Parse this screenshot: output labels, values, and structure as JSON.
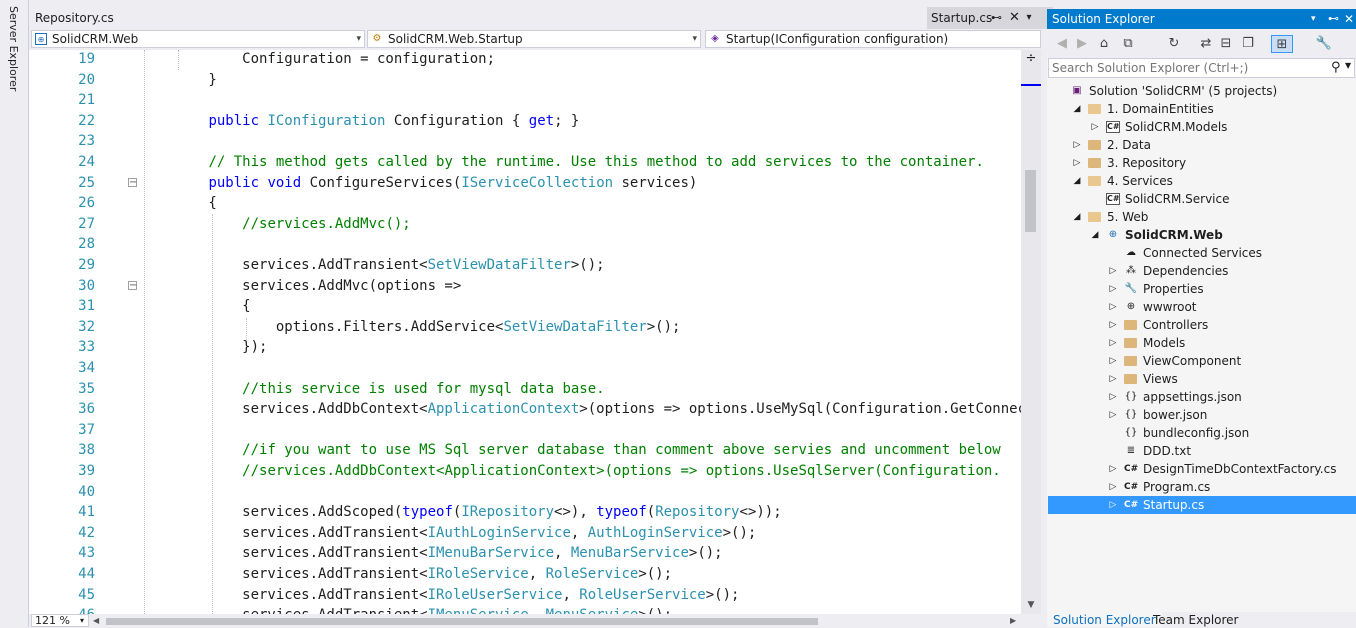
{
  "server_explorer": {
    "label": "Server Explorer"
  },
  "tabs": {
    "repository": "Repository.cs",
    "startup": "Startup.cs",
    "pin_glyph": "⊷",
    "close_glyph": "✕",
    "dropdown_glyph": "▾"
  },
  "navbar": {
    "project": "SolidCRM.Web",
    "type": "SolidCRM.Web.Startup",
    "member": "Startup(IConfiguration configuration)",
    "caret": "▾"
  },
  "editor": {
    "lines": [
      {
        "num": "19",
        "segs": [
          [
            "p",
            "            Configuration = configuration;"
          ]
        ]
      },
      {
        "num": "20",
        "segs": [
          [
            "p",
            "        }"
          ]
        ]
      },
      {
        "num": "21",
        "segs": []
      },
      {
        "num": "22",
        "segs": [
          [
            "p",
            "        "
          ],
          [
            "k",
            "public"
          ],
          [
            "p",
            " "
          ],
          [
            "t",
            "IConfiguration"
          ],
          [
            "p",
            " Configuration { "
          ],
          [
            "k",
            "get"
          ],
          [
            "p",
            "; }"
          ]
        ]
      },
      {
        "num": "23",
        "segs": []
      },
      {
        "num": "24",
        "segs": [
          [
            "p",
            "        "
          ],
          [
            "c",
            "// This method gets called by the runtime. Use this method to add services to the container."
          ]
        ]
      },
      {
        "num": "25",
        "segs": [
          [
            "p",
            "        "
          ],
          [
            "k",
            "public"
          ],
          [
            "p",
            " "
          ],
          [
            "k",
            "void"
          ],
          [
            "p",
            " ConfigureServices("
          ],
          [
            "t",
            "IServiceCollection"
          ],
          [
            "p",
            " services)"
          ]
        ],
        "fold": "−"
      },
      {
        "num": "26",
        "segs": [
          [
            "p",
            "        {"
          ]
        ]
      },
      {
        "num": "27",
        "segs": [
          [
            "p",
            "            "
          ],
          [
            "c",
            "//services.AddMvc();"
          ]
        ]
      },
      {
        "num": "28",
        "segs": []
      },
      {
        "num": "29",
        "segs": [
          [
            "p",
            "            services.AddTransient<"
          ],
          [
            "t",
            "SetViewDataFilter"
          ],
          [
            "p",
            ">();"
          ]
        ]
      },
      {
        "num": "30",
        "segs": [
          [
            "p",
            "            services.AddMvc(options =>"
          ]
        ],
        "fold": "−"
      },
      {
        "num": "31",
        "segs": [
          [
            "p",
            "            {"
          ]
        ]
      },
      {
        "num": "32",
        "segs": [
          [
            "p",
            "                options.Filters.AddService<"
          ],
          [
            "t",
            "SetViewDataFilter"
          ],
          [
            "p",
            ">();"
          ]
        ]
      },
      {
        "num": "33",
        "segs": [
          [
            "p",
            "            });"
          ]
        ]
      },
      {
        "num": "34",
        "segs": []
      },
      {
        "num": "35",
        "segs": [
          [
            "p",
            "            "
          ],
          [
            "c",
            "//this service is used for mysql data base."
          ]
        ]
      },
      {
        "num": "36",
        "segs": [
          [
            "p",
            "            services.AddDbContext<"
          ],
          [
            "t",
            "ApplicationContext"
          ],
          [
            "p",
            ">(options => options.UseMySql(Configuration.GetConnectionString("
          ]
        ]
      },
      {
        "num": "37",
        "segs": []
      },
      {
        "num": "38",
        "segs": [
          [
            "p",
            "            "
          ],
          [
            "c",
            "//if you want to use MS Sql server database than comment above servies and uncomment below"
          ]
        ]
      },
      {
        "num": "39",
        "segs": [
          [
            "p",
            "            "
          ],
          [
            "c",
            "//services.AddDbContext<ApplicationContext>(options => options.UseSqlServer(Configuration."
          ]
        ]
      },
      {
        "num": "40",
        "segs": []
      },
      {
        "num": "41",
        "segs": [
          [
            "p",
            "            services.AddScoped("
          ],
          [
            "k",
            "typeof"
          ],
          [
            "p",
            "("
          ],
          [
            "t",
            "IRepository"
          ],
          [
            "p",
            "<>), "
          ],
          [
            "k",
            "typeof"
          ],
          [
            "p",
            "("
          ],
          [
            "t",
            "Repository"
          ],
          [
            "p",
            "<>));"
          ]
        ]
      },
      {
        "num": "42",
        "segs": [
          [
            "p",
            "            services.AddTransient<"
          ],
          [
            "t",
            "IAuthLoginService"
          ],
          [
            "p",
            ", "
          ],
          [
            "t",
            "AuthLoginService"
          ],
          [
            "p",
            ">();"
          ]
        ]
      },
      {
        "num": "43",
        "segs": [
          [
            "p",
            "            services.AddTransient<"
          ],
          [
            "t",
            "IMenuBarService"
          ],
          [
            "p",
            ", "
          ],
          [
            "t",
            "MenuBarService"
          ],
          [
            "p",
            ">();"
          ]
        ]
      },
      {
        "num": "44",
        "segs": [
          [
            "p",
            "            services.AddTransient<"
          ],
          [
            "t",
            "IRoleService"
          ],
          [
            "p",
            ", "
          ],
          [
            "t",
            "RoleService"
          ],
          [
            "p",
            ">();"
          ]
        ]
      },
      {
        "num": "45",
        "segs": [
          [
            "p",
            "            services.AddTransient<"
          ],
          [
            "t",
            "IRoleUserService"
          ],
          [
            "p",
            ", "
          ],
          [
            "t",
            "RoleUserService"
          ],
          [
            "p",
            ">();"
          ]
        ]
      },
      {
        "num": "46",
        "segs": [
          [
            "p",
            "            services.AddTransient<"
          ],
          [
            "t",
            "IMenuService"
          ],
          [
            "p",
            ", "
          ],
          [
            "t",
            "MenuService"
          ],
          [
            "p",
            ">();"
          ]
        ]
      }
    ],
    "colors": {
      "keyword": "#0000ff",
      "type": "#2b91af",
      "comment": "#008000",
      "plain": "#1e1e1e",
      "line_number": "#2b91af"
    }
  },
  "zoom": {
    "value": "121 %",
    "caret": "▾"
  },
  "solution_explorer": {
    "title": "Solution Explorer",
    "title_buttons": [
      "▾",
      "⊷",
      "✕"
    ],
    "toolbar_icons": [
      {
        "name": "back-icon",
        "glyph": "◀"
      },
      {
        "name": "forward-icon",
        "glyph": "▶"
      },
      {
        "name": "home-icon",
        "glyph": "⌂"
      },
      {
        "name": "switch-views-icon",
        "glyph": "⧉"
      },
      {
        "name": "pending-changes-icon",
        "glyph": "↻"
      },
      {
        "name": "sync-icon",
        "glyph": "⇄"
      },
      {
        "name": "collapse-all-icon",
        "glyph": "⊟"
      },
      {
        "name": "show-all-files-icon",
        "glyph": "❐"
      },
      {
        "name": "preview-selected-icon",
        "glyph": "⊞"
      },
      {
        "name": "properties-icon",
        "glyph": "🔧"
      }
    ],
    "search_placeholder": "Search Solution Explorer (Ctrl+;)",
    "search_glyph": "⚲",
    "tree": [
      {
        "label": "Solution 'SolidCRM' (5 projects)",
        "depth": 0,
        "arrow": "",
        "icon": "solution"
      },
      {
        "label": "1. DomainEntities",
        "depth": 1,
        "arrow": "◢",
        "icon": "folder-open"
      },
      {
        "label": "SolidCRM.Models",
        "depth": 2,
        "arrow": "▷",
        "icon": "csproj"
      },
      {
        "label": "2. Data",
        "depth": 1,
        "arrow": "▷",
        "icon": "folder"
      },
      {
        "label": "3. Repository",
        "depth": 1,
        "arrow": "▷",
        "icon": "folder"
      },
      {
        "label": "4. Services",
        "depth": 1,
        "arrow": "◢",
        "icon": "folder-open"
      },
      {
        "label": "SolidCRM.Service",
        "depth": 2,
        "arrow": "",
        "icon": "csproj"
      },
      {
        "label": "5. Web",
        "depth": 1,
        "arrow": "◢",
        "icon": "folder-open"
      },
      {
        "label": "SolidCRM.Web",
        "depth": 2,
        "arrow": "◢",
        "icon": "webproj",
        "bold": true
      },
      {
        "label": "Connected Services",
        "depth": 3,
        "arrow": "",
        "icon": "connected"
      },
      {
        "label": "Dependencies",
        "depth": 3,
        "arrow": "▷",
        "icon": "deps"
      },
      {
        "label": "Properties",
        "depth": 3,
        "arrow": "▷",
        "icon": "wrench"
      },
      {
        "label": "wwwroot",
        "depth": 3,
        "arrow": "▷",
        "icon": "globe"
      },
      {
        "label": "Controllers",
        "depth": 3,
        "arrow": "▷",
        "icon": "folder"
      },
      {
        "label": "Models",
        "depth": 3,
        "arrow": "▷",
        "icon": "folder"
      },
      {
        "label": "ViewComponent",
        "depth": 3,
        "arrow": "▷",
        "icon": "folder"
      },
      {
        "label": "Views",
        "depth": 3,
        "arrow": "▷",
        "icon": "folder"
      },
      {
        "label": "appsettings.json",
        "depth": 3,
        "arrow": "▷",
        "icon": "json"
      },
      {
        "label": "bower.json",
        "depth": 3,
        "arrow": "▷",
        "icon": "json"
      },
      {
        "label": "bundleconfig.json",
        "depth": 3,
        "arrow": "",
        "icon": "json"
      },
      {
        "label": "DDD.txt",
        "depth": 3,
        "arrow": "",
        "icon": "txt"
      },
      {
        "label": "DesignTimeDbContextFactory.cs",
        "depth": 3,
        "arrow": "▷",
        "icon": "cs"
      },
      {
        "label": "Program.cs",
        "depth": 3,
        "arrow": "▷",
        "icon": "cs"
      },
      {
        "label": "Startup.cs",
        "depth": 3,
        "arrow": "▷",
        "icon": "cs",
        "selected": true
      }
    ],
    "bottom_tabs": [
      "Solution Explorer",
      "Team Explorer"
    ]
  }
}
